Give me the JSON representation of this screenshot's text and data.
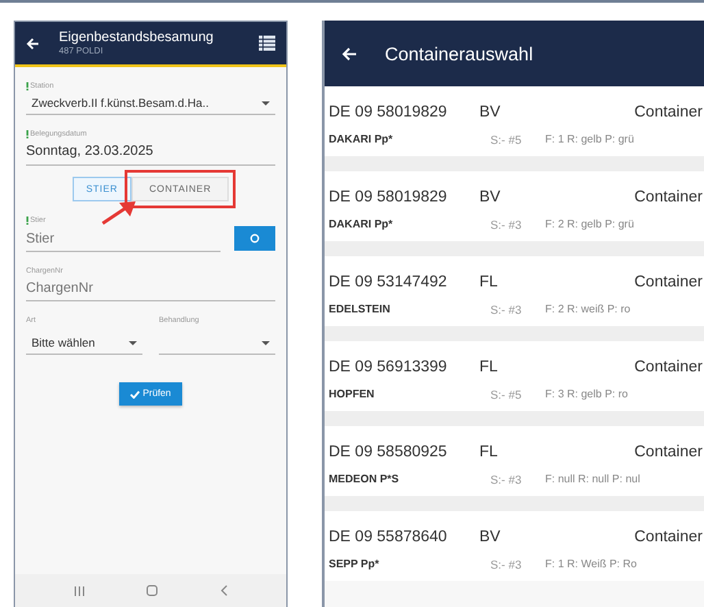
{
  "left_screen": {
    "title": "Eigenbestandsbesamung",
    "subtitle": "487 POLDI",
    "station": {
      "label": "Station",
      "required": true,
      "value": "Zweckverb.II f.künst.Besam.d.Ha.."
    },
    "date": {
      "label": "Belegungsdatum",
      "required": true,
      "value": "Sonntag, 23.03.2025"
    },
    "mode_buttons": [
      {
        "label": "STIER",
        "selected": true,
        "highlighted": false
      },
      {
        "label": "CONTAINER",
        "selected": false,
        "highlighted": true
      }
    ],
    "stier": {
      "label": "Stier",
      "required": true,
      "placeholder": "Stier"
    },
    "charge": {
      "label": "ChargenNr",
      "required": false,
      "placeholder": "ChargenNr"
    },
    "art": {
      "label": "Art",
      "value": "Bitte wählen"
    },
    "behandlung": {
      "label": "Behandlung"
    },
    "check_button": "Prüfen"
  },
  "right_screen": {
    "title": "Containerauswahl",
    "rows": [
      {
        "id": "DE 09 58019829",
        "type": "BV",
        "container": "Container",
        "name": "DAKARI Pp*",
        "slot": "S:- #5",
        "details": "F: 1 R: gelb P: grü"
      },
      {
        "id": "DE 09 58019829",
        "type": "BV",
        "container": "Container",
        "name": "DAKARI Pp*",
        "slot": "S:- #3",
        "details": "F: 2 R: gelb P: grü"
      },
      {
        "id": "DE 09 53147492",
        "type": "FL",
        "container": "Container",
        "name": "EDELSTEIN",
        "slot": "S:- #3",
        "details": "F: 2 R: weiß P: ro"
      },
      {
        "id": "DE 09 56913399",
        "type": "FL",
        "container": "Container",
        "name": "HOPFEN",
        "slot": "S:- #5",
        "details": "F: 3 R: gelb P: ro"
      },
      {
        "id": "DE 09 58580925",
        "type": "FL",
        "container": "Container",
        "name": "MEDEON P*S",
        "slot": "S:- #3",
        "details": "F: null R: null P: nul"
      },
      {
        "id": "DE 09 55878640",
        "type": "BV",
        "container": "Container",
        "name": "SEPP Pp*",
        "slot": "S:- #3",
        "details": "F: 1 R: Weiß P: Ro"
      }
    ]
  }
}
